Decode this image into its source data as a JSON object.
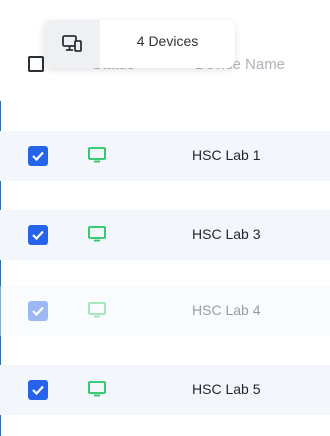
{
  "tooltip": {
    "device_count": "4 Devices",
    "icon": "devices-icon"
  },
  "header": {
    "status_label": "Status",
    "name_label": "Device Name"
  },
  "colors": {
    "accent": "#2563eb",
    "device_green": "#22c55e"
  },
  "rows": [
    {
      "name": "HSC Lab 1",
      "checked": true,
      "dim": false
    },
    {
      "name": "HSC Lab 3",
      "checked": true,
      "dim": false
    },
    {
      "name": "HSC Lab 4",
      "checked": true,
      "dim": true
    },
    {
      "name": "HSC Lab 5",
      "checked": true,
      "dim": false
    }
  ]
}
